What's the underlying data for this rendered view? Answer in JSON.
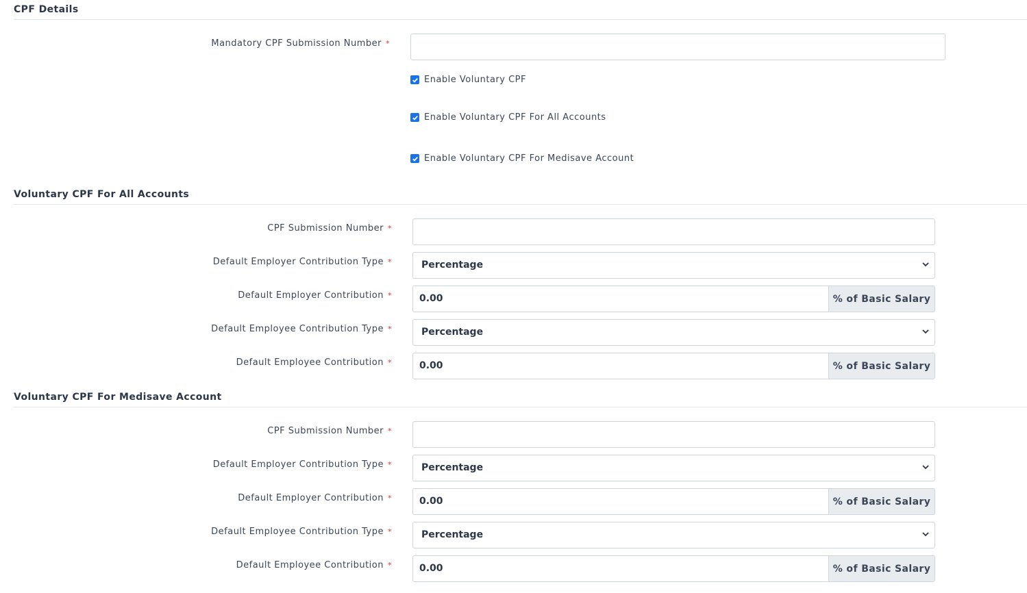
{
  "cpf_details": {
    "title": "CPF Details",
    "mandatory_label": "Mandatory CPF Submission Number",
    "mandatory_value": "",
    "checkboxes": [
      {
        "label": "Enable Voluntary CPF",
        "checked": true
      },
      {
        "label": "Enable Voluntary CPF For All Accounts",
        "checked": true
      },
      {
        "label": "Enable Voluntary CPF For Medisave Account",
        "checked": true
      }
    ]
  },
  "all_accounts": {
    "title": "Voluntary CPF For All Accounts",
    "submission_label": "CPF Submission Number",
    "submission_value": "",
    "employer_type_label": "Default Employer Contribution Type",
    "employer_type_value": "Percentage",
    "employer_contrib_label": "Default Employer Contribution",
    "employer_contrib_value": "0.00",
    "employer_contrib_unit": "% of Basic Salary",
    "employee_type_label": "Default Employee Contribution Type",
    "employee_type_value": "Percentage",
    "employee_contrib_label": "Default Employee Contribution",
    "employee_contrib_value": "0.00",
    "employee_contrib_unit": "% of Basic Salary"
  },
  "medisave": {
    "title": "Voluntary CPF For Medisave Account",
    "submission_label": "CPF Submission Number",
    "submission_value": "",
    "employer_type_label": "Default Employer Contribution Type",
    "employer_type_value": "Percentage",
    "employer_contrib_label": "Default Employer Contribution",
    "employer_contrib_value": "0.00",
    "employer_contrib_unit": "% of Basic Salary",
    "employee_type_label": "Default Employee Contribution Type",
    "employee_type_value": "Percentage",
    "employee_contrib_label": "Default Employee Contribution",
    "employee_contrib_value": "0.00",
    "employee_contrib_unit": "% of Basic Salary"
  },
  "required_marker": "*",
  "colors": {
    "checkbox": "#1a73e8",
    "required": "#e3342f",
    "addon_bg": "#e9ecef"
  }
}
